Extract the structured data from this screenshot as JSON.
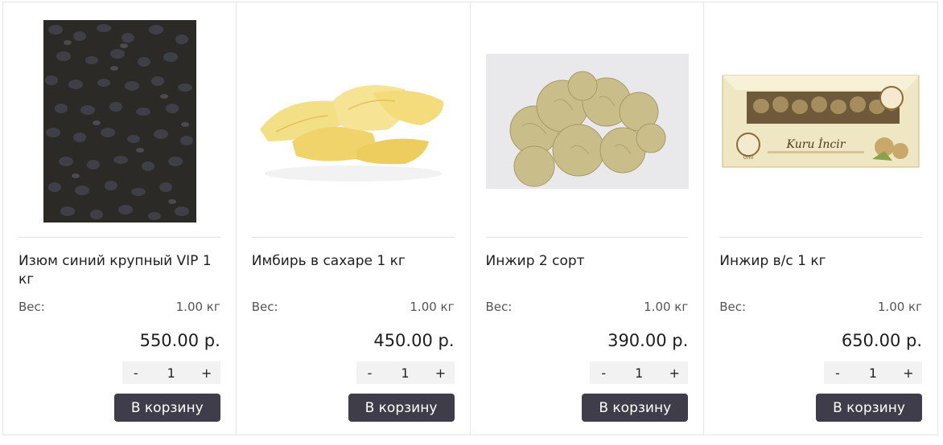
{
  "products": [
    {
      "name": "Изюм синий крупный VIP 1 кг",
      "weight_label": "Вес:",
      "weight_value": "1.00 кг",
      "price": "550.00 р.",
      "qty": "1",
      "minus": "-",
      "plus": "+",
      "cart_label": "В корзину"
    },
    {
      "name": "Имбирь в сахаре 1 кг",
      "weight_label": "Вес:",
      "weight_value": "1.00 кг",
      "price": "450.00 р.",
      "qty": "1",
      "minus": "-",
      "plus": "+",
      "cart_label": "В корзину"
    },
    {
      "name": "Инжир 2 сорт",
      "weight_label": "Вес:",
      "weight_value": "1.00 кг",
      "price": "390.00 р.",
      "qty": "1",
      "minus": "-",
      "plus": "+",
      "cart_label": "В корзину"
    },
    {
      "name": "Инжир в/с 1 кг",
      "weight_label": "Вес:",
      "weight_value": "1.00 кг",
      "price": "650.00 р.",
      "qty": "1",
      "minus": "-",
      "plus": "+",
      "cart_label": "В корзину"
    }
  ],
  "package": {
    "brand": "Kuru İncir",
    "seal": "Örnl"
  },
  "colors": {
    "button_bg": "#3f3d4a",
    "qty_bg": "#f2f2f2",
    "border": "#e6e6e6"
  }
}
